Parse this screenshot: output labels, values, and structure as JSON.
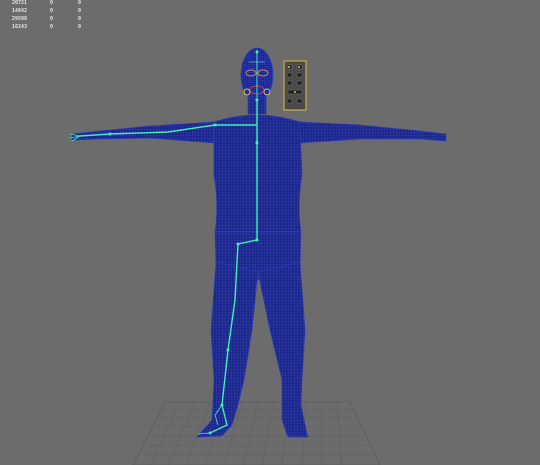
{
  "hud": {
    "rows": [
      [
        "20721",
        "0",
        "0"
      ],
      [
        "14842",
        "0",
        "0"
      ],
      [
        "29598",
        "0",
        "0"
      ],
      [
        "16243",
        "0",
        "0"
      ]
    ]
  },
  "colors": {
    "background": "#6c6c6c",
    "mesh": "#1e2b8f",
    "mesh_wire": "#3a49c8",
    "skeleton": "#3ff0b4",
    "grid": "#5a5a5a",
    "face_control": "#d9b43a"
  },
  "scene": {
    "description_free": true
  }
}
